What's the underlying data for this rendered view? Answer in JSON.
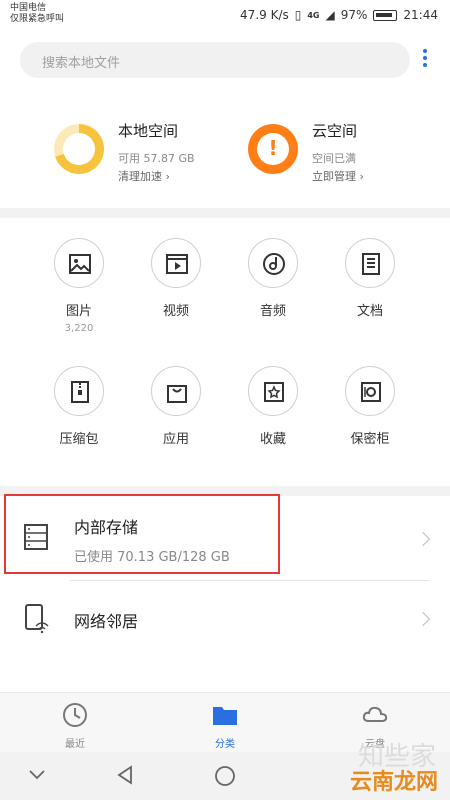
{
  "status_bar": {
    "carrier_line1": "中国电信",
    "carrier_line2": "仅限紧急呼叫",
    "speed": "47.9 K/s",
    "network": "4G",
    "battery": "97%",
    "time": "21:44"
  },
  "search": {
    "placeholder": "搜索本地文件"
  },
  "summary": {
    "local": {
      "title": "本地空间",
      "available": "可用 57.87 GB",
      "action": "清理加速 ›",
      "used_fraction": 0.7
    },
    "cloud": {
      "title": "云空间",
      "status": "空间已满",
      "action": "立即管理 ›"
    }
  },
  "categories": [
    {
      "label": "图片",
      "count": "3,220",
      "icon": "image-icon"
    },
    {
      "label": "视频",
      "count": "",
      "icon": "video-icon"
    },
    {
      "label": "音频",
      "count": "",
      "icon": "music-icon"
    },
    {
      "label": "文档",
      "count": "",
      "icon": "document-icon"
    },
    {
      "label": "压缩包",
      "count": "",
      "icon": "archive-icon"
    },
    {
      "label": "应用",
      "count": "",
      "icon": "app-bag-icon"
    },
    {
      "label": "收藏",
      "count": "",
      "icon": "star-icon"
    },
    {
      "label": "保密柜",
      "count": "",
      "icon": "safe-icon"
    }
  ],
  "internal_storage": {
    "title": "内部存储",
    "usage": "已使用 70.13 GB/128 GB"
  },
  "network_neighbors": {
    "title": "网络邻居"
  },
  "bottom_nav": [
    {
      "label": "最近",
      "icon": "clock-icon",
      "active": false
    },
    {
      "label": "分类",
      "icon": "folder-icon",
      "active": true
    },
    {
      "label": "云盘",
      "icon": "cloud-icon",
      "active": false
    }
  ],
  "watermark": "云南龙网",
  "watermark_faint": "知些家",
  "colors": {
    "accent": "#2a6fe0",
    "warning": "#ff7f17",
    "local_ring": "#f6c33c",
    "highlight": "#e53935"
  }
}
